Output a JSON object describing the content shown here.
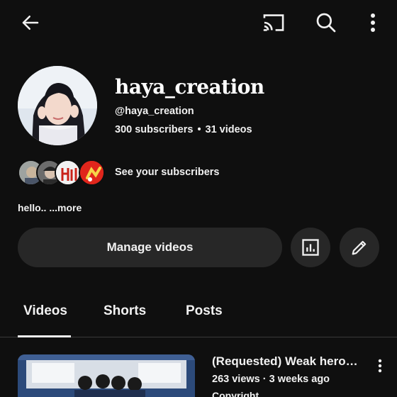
{
  "topbar": {
    "icons": [
      "back-arrow-icon",
      "cast-icon",
      "search-icon",
      "more-vert-icon"
    ]
  },
  "channel": {
    "name": "haya_creation",
    "handle": "@haya_creation",
    "subscribers": "300 subscribers",
    "separator": "•",
    "videos": "31 videos",
    "see_subscribers": "See your subscribers",
    "bio": "hello..",
    "bio_more": "...more"
  },
  "actions": {
    "manage_label": "Manage videos",
    "analytics_icon": "analytics-icon",
    "edit_icon": "edit-pencil-icon"
  },
  "tabs": [
    {
      "label": "Videos",
      "active": true
    },
    {
      "label": "Shorts",
      "active": false
    },
    {
      "label": "Posts",
      "active": false
    }
  ],
  "videos": [
    {
      "title": "(Requested) Weak hero cl...",
      "meta": "263 views · 3 weeks ago",
      "sub": "Copyright"
    }
  ],
  "colors": {
    "background": "#0f0f0f",
    "button_bg": "#272727",
    "text": "#f1f1f1",
    "sub_avatar_red": "#e0261c"
  }
}
